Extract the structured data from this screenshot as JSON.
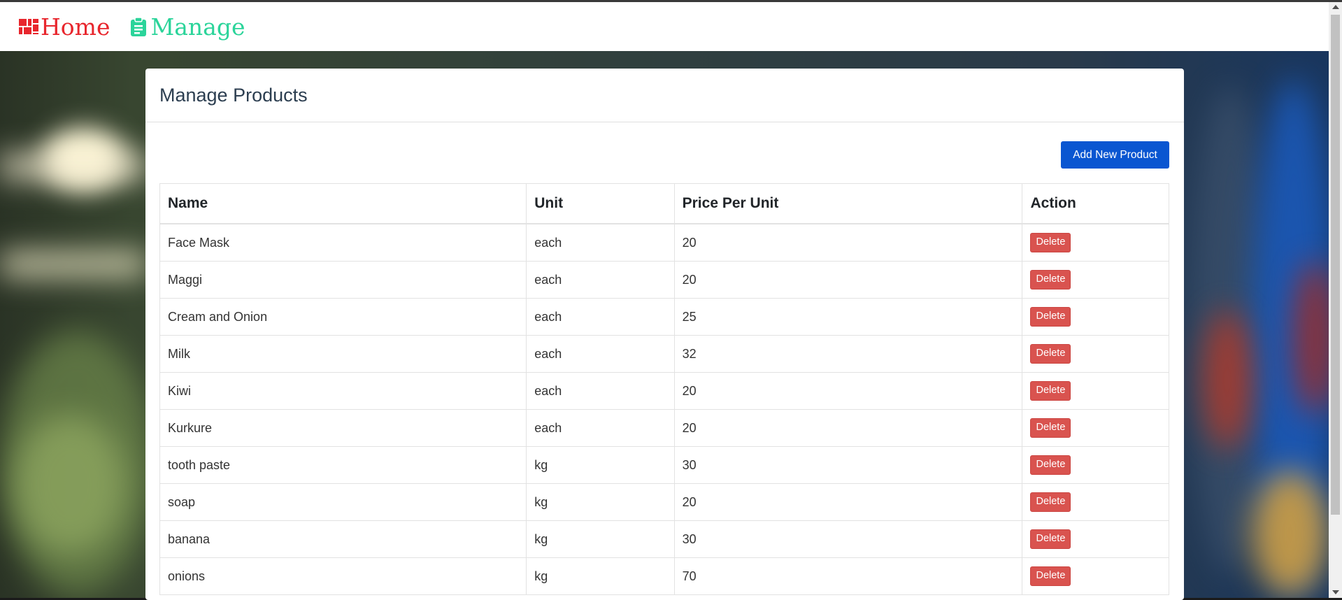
{
  "nav": {
    "home_label": "Home",
    "manage_label": "Manage"
  },
  "page": {
    "title": "Manage Products",
    "add_button_label": "Add New Product"
  },
  "table": {
    "headers": {
      "name": "Name",
      "unit": "Unit",
      "price": "Price Per Unit",
      "action": "Action"
    },
    "delete_label": "Delete",
    "rows": [
      {
        "name": "Face Mask",
        "unit": "each",
        "price": "20"
      },
      {
        "name": "Maggi",
        "unit": "each",
        "price": "20"
      },
      {
        "name": "Cream and Onion",
        "unit": "each",
        "price": "25"
      },
      {
        "name": "Milk",
        "unit": "each",
        "price": "32"
      },
      {
        "name": "Kiwi",
        "unit": "each",
        "price": "20"
      },
      {
        "name": "Kurkure",
        "unit": "each",
        "price": "20"
      },
      {
        "name": "tooth paste",
        "unit": "kg",
        "price": "30"
      },
      {
        "name": "soap",
        "unit": "kg",
        "price": "20"
      },
      {
        "name": "banana",
        "unit": "kg",
        "price": "30"
      },
      {
        "name": "onions",
        "unit": "kg",
        "price": "70"
      }
    ]
  },
  "icons": {
    "home": "dashboard-icon",
    "manage": "clipboard-icon"
  },
  "colors": {
    "home": "#e8262d",
    "manage": "#2bd49a",
    "primary": "#0a56d1",
    "danger": "#d9534f"
  }
}
